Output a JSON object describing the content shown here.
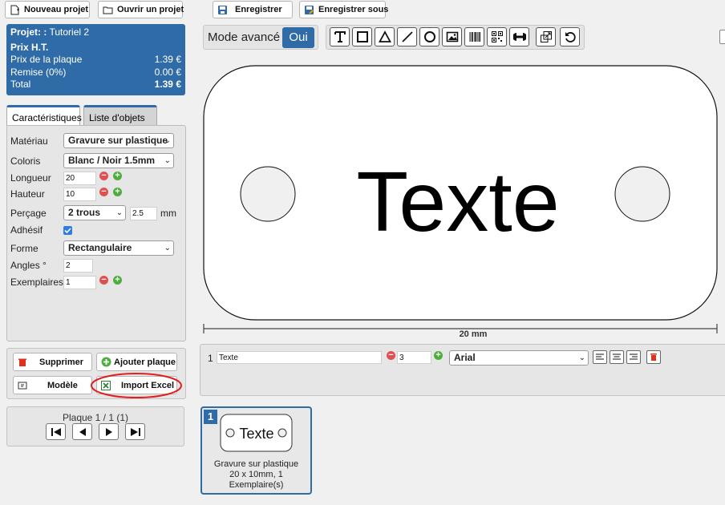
{
  "topbar": {
    "new_project": "Nouveau projet",
    "open_project": "Ouvrir un projet",
    "save": "Enregistrer",
    "save_as": "Enregistrer sous"
  },
  "project": {
    "label": "Projet: :",
    "name": "Tutoriel 2",
    "price_heading": "Prix H.T.",
    "plate_price_label": "Prix de la plaque",
    "plate_price": "1.39 €",
    "discount_label": "Remise (0%)",
    "discount": "0.00 €",
    "total_label": "Total",
    "total": "1.39 €"
  },
  "tabs": {
    "characteristics": "Caractéristiques",
    "objects": "Liste d'objets"
  },
  "form": {
    "material_label": "Matériau",
    "material_value": "Gravure sur plastique",
    "color_label": "Coloris",
    "color_value": "Blanc / Noir 1.5mm",
    "length_label": "Longueur",
    "length_value": "20",
    "height_label": "Hauteur",
    "height_value": "10",
    "drilling_label": "Perçage",
    "drilling_value": "2 trous",
    "drilling_size": "2.5",
    "drilling_unit": "mm",
    "adhesive_label": "Adhésif",
    "adhesive_checked": true,
    "shape_label": "Forme",
    "shape_value": "Rectangulaire",
    "angles_label": "Angles °",
    "angles_value": "2",
    "copies_label": "Exemplaires",
    "copies_value": "1"
  },
  "actions": {
    "delete": "Supprimer",
    "add_plate": "Ajouter plaque",
    "template": "Modèle",
    "import_excel": "Import Excel"
  },
  "pager": {
    "label": "Plaque 1 / 1 (1)"
  },
  "mode": {
    "label": "Mode avancé",
    "toggle": "Oui"
  },
  "canvas": {
    "text": "Texte",
    "dimension": "20 mm"
  },
  "text_object": {
    "index": "1",
    "value": "Texte",
    "size": "3",
    "font": "Arial"
  },
  "thumbnail": {
    "index": "1",
    "text": "Texte",
    "desc_line1": "Gravure sur plastique",
    "desc_line2": "20 x 10mm, 1",
    "desc_line3": "Exemplaire(s)"
  },
  "colors": {
    "accent": "#2f6ba6",
    "highlight_circle": "#e02020",
    "delete_red": "#e03020",
    "add_green": "#4cae3c"
  }
}
